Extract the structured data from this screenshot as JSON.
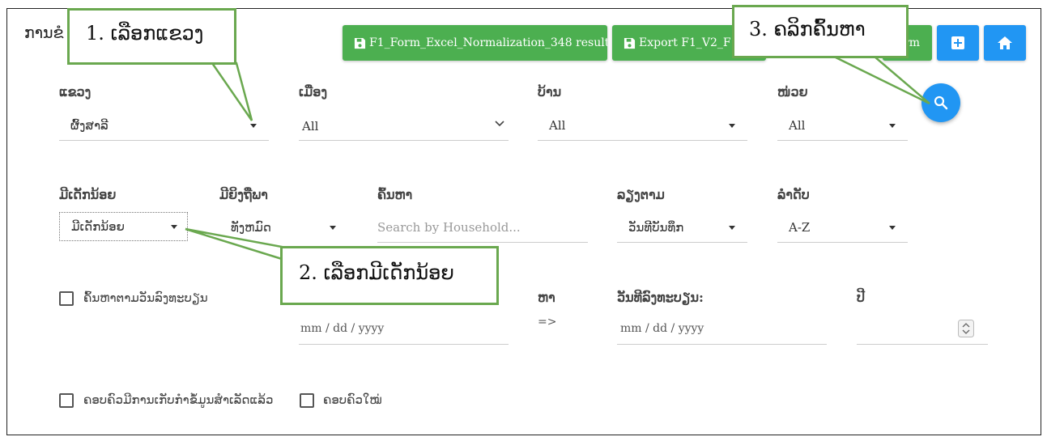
{
  "page": {
    "title": "ການຂໍ"
  },
  "toolbar": {
    "btn_normalization": "F1_Form_Excel_Normalization_348 result",
    "btn_export": "Export F1_V2_F",
    "btn_export_tail": "rm"
  },
  "filters": {
    "province": {
      "label": "ແຂວງ",
      "value": "ຜົ້ງສາລີ"
    },
    "district": {
      "label": "ເມືອງ",
      "value": "All"
    },
    "village": {
      "label": "ບ້ານ",
      "value": "All"
    },
    "unit": {
      "label": "ໜ່ວຍ",
      "value": "All"
    },
    "child": {
      "label": "ມີເດັກນ້ອຍ",
      "value": "ມີເດັກນ້ອຍ"
    },
    "pregnant": {
      "label": "ມີຍິງຖືພາ",
      "value": "ທັງຫມົດ"
    },
    "search": {
      "label": "ຄົ້ນຫາ",
      "placeholder": "Search by Household..."
    },
    "sort_by": {
      "label": "ລຽງຕາມ",
      "value": "ວັນທີບັນທຶກ"
    },
    "order": {
      "label": "ລໍາດັບ",
      "value": "A-Z"
    },
    "date_search_label": "ຄົ້ນຫາຕາມວັນລົງທະບຽນ",
    "to_label": "ຫາ",
    "arrow": "=>",
    "reg_date_label": "ວັນທີລົງທະບຽນ:",
    "year_label": "ປີ",
    "date_from_placeholder": "mm / dd / yyyy",
    "date_to_placeholder": "mm / dd / yyyy",
    "chk_completed": "ຄອບຄົວມີການເກັບກໍາຂໍ້ມູນສໍາເລັດແລ້ວ",
    "chk_new": "ຄອບຄົວໃໝ່"
  },
  "annotations": {
    "step1": "1. ເລືອກແຂວງ",
    "step2": "2. ເລືອກມີເດັກນ້ອຍ",
    "step3": "3. ຄລິກຄົ້ນຫາ"
  },
  "colors": {
    "green": "#4caf50",
    "blue": "#2196f3",
    "callout_border": "#6aa84f"
  },
  "icons": [
    "save-icon",
    "plus-icon",
    "home-icon",
    "search-icon"
  ]
}
